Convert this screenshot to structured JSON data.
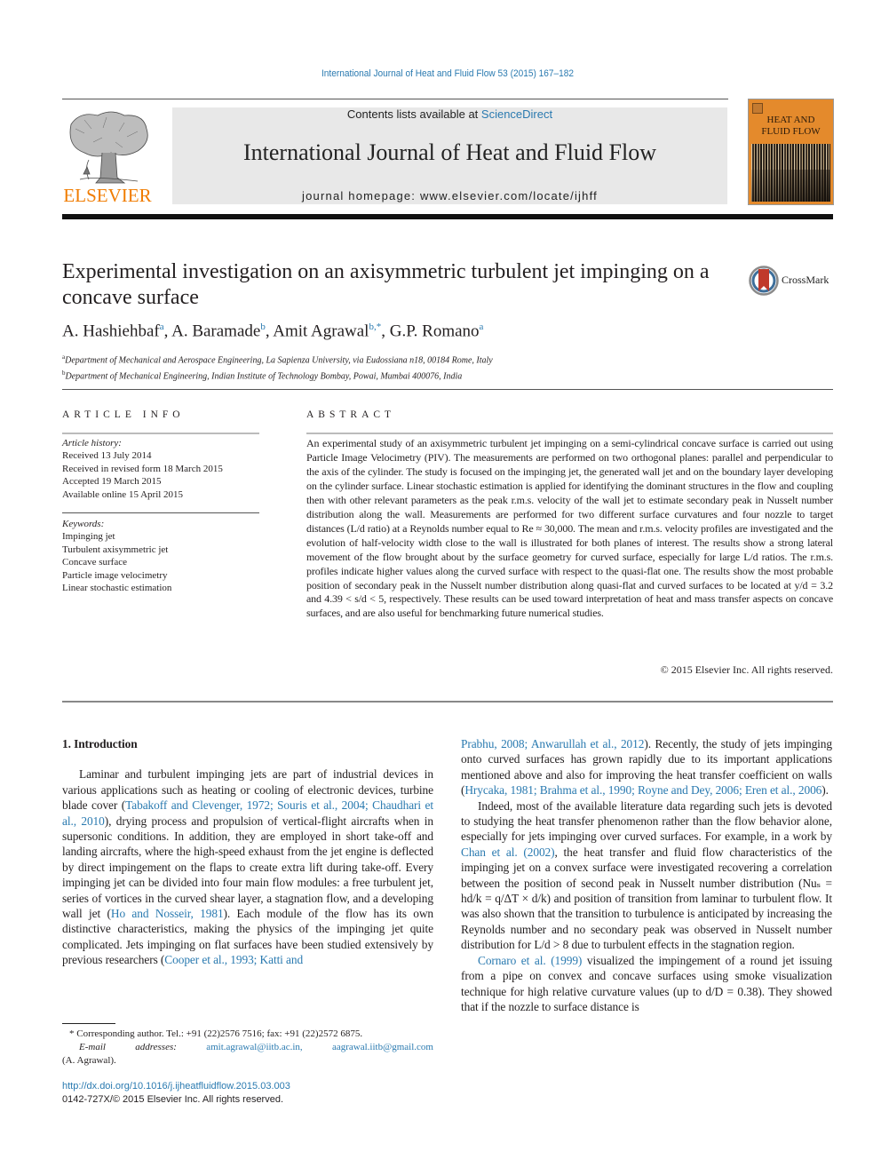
{
  "header": {
    "journal_ref": "International Journal of Heat and Fluid Flow 53 (2015) 167–182",
    "contents_prefix": "Contents lists available at ",
    "contents_link": "ScienceDirect",
    "journal_title": "International Journal of Heat and Fluid Flow",
    "homepage_prefix": "journal homepage: ",
    "homepage_url": "www.elsevier.com/locate/ijhff",
    "publisher_logo_text": "ELSEVIER",
    "cover_title_line1": "HEAT AND",
    "cover_title_line2": "FLUID FLOW",
    "colors": {
      "elsevier_orange": "#f07c00",
      "link_blue": "#2a7ab0",
      "cover_orange": "#e48a2c",
      "banner_gray": "#e8e8e8"
    }
  },
  "article": {
    "title": "Experimental investigation on an axisymmetric turbulent jet impinging on a concave surface",
    "crossmark_label": "CrossMark",
    "authors": [
      {
        "name": "A. Hashiehbaf",
        "sup": "a"
      },
      {
        "name": "A. Baramade",
        "sup": "b"
      },
      {
        "name": "Amit Agrawal",
        "sup": "b,*"
      },
      {
        "name": "G.P. Romano",
        "sup": "a"
      }
    ],
    "affiliations": [
      {
        "sup": "a",
        "text": "Department of Mechanical and Aerospace Engineering, La Sapienza University, via Eudossiana n18, 00184 Rome, Italy"
      },
      {
        "sup": "b",
        "text": "Department of Mechanical Engineering, Indian Institute of Technology Bombay, Powai, Mumbai 400076, India"
      }
    ]
  },
  "article_info": {
    "heading": "ARTICLE INFO",
    "history_label": "Article history:",
    "history": [
      "Received 13 July 2014",
      "Received in revised form 18 March 2015",
      "Accepted 19 March 2015",
      "Available online 15 April 2015"
    ],
    "keywords_label": "Keywords:",
    "keywords": [
      "Impinging jet",
      "Turbulent axisymmetric jet",
      "Concave surface",
      "Particle image velocimetry",
      "Linear stochastic estimation"
    ]
  },
  "abstract": {
    "heading": "ABSTRACT",
    "text": "An experimental study of an axisymmetric turbulent jet impinging on a semi-cylindrical concave surface is carried out using Particle Image Velocimetry (PIV). The measurements are performed on two orthogonal planes: parallel and perpendicular to the axis of the cylinder. The study is focused on the impinging jet, the generated wall jet and on the boundary layer developing on the cylinder surface. Linear stochastic estimation is applied for identifying the dominant structures in the flow and coupling then with other relevant parameters as the peak r.m.s. velocity of the wall jet to estimate secondary peak in Nusselt number distribution along the wall. Measurements are performed for two different surface curvatures and four nozzle to target distances (L/d ratio) at a Reynolds number equal to Re ≈ 30,000. The mean and r.m.s. velocity profiles are investigated and the evolution of half-velocity width close to the wall is illustrated for both planes of interest. The results show a strong lateral movement of the flow brought about by the surface geometry for curved surface, especially for large L/d ratios. The r.m.s. profiles indicate higher values along the curved surface with respect to the quasi-flat one. The results show the most probable position of secondary peak in the Nusselt number distribution along quasi-flat and curved surfaces to be located at y/d = 3.2 and 4.39 < s/d < 5, respectively. These results can be used toward interpretation of heat and mass transfer aspects on concave surfaces, and are also useful for benchmarking future numerical studies.",
    "copyright": "© 2015 Elsevier Inc. All rights reserved."
  },
  "body": {
    "section_heading": "1. Introduction",
    "left_p1": [
      {
        "t": "Laminar and turbulent impinging jets are part of industrial devices in various applications such as heating or cooling of electronic devices, turbine blade cover ("
      },
      {
        "t": "Tabakoff and Clevenger, 1972; Souris et al., 2004; Chaudhari et al., 2010",
        "link": true
      },
      {
        "t": "), drying process and propulsion of vertical-flight aircrafts when in supersonic conditions. In addition, they are employed in short take-off and landing aircrafts, where the high-speed exhaust from the jet engine is deflected by direct impingement on the flaps to create extra lift during take-off. Every impinging jet can be divided into four main flow modules: a free turbulent jet, series of vortices in the curved shear layer, a stagnation flow, and a developing wall jet ("
      },
      {
        "t": "Ho and Nosseir, 1981",
        "link": true
      },
      {
        "t": "). Each module of the flow has its own distinctive characteristics, making the physics of the impinging jet quite complicated. Jets impinging on flat surfaces have been studied extensively by previous researchers ("
      },
      {
        "t": "Cooper et al., 1993; Katti and",
        "link": true
      }
    ],
    "right_p1": [
      {
        "t": "Prabhu, 2008; Anwarullah et al., 2012",
        "link": true
      },
      {
        "t": "). Recently, the study of jets impinging onto curved surfaces has grown rapidly due to its important applications mentioned above and also for improving the heat transfer coefficient on walls ("
      },
      {
        "t": "Hrycaka, 1981; Brahma et al., 1990; Royne and Dey, 2006; Eren et al., 2006",
        "link": true
      },
      {
        "t": ")."
      }
    ],
    "right_p2": [
      {
        "t": "Indeed, most of the available literature data regarding such jets is devoted to studying the heat transfer phenomenon rather than the flow behavior alone, especially for jets impinging over curved surfaces. For example, in a work by "
      },
      {
        "t": "Chan et al. (2002)",
        "link": true
      },
      {
        "t": ", the heat transfer and fluid flow characteristics of the impinging jet on a convex surface were investigated recovering a correlation between the position of second peak in Nusselt number distribution (Nuₛ = hd/k = q/ΔT × d/k) and position of transition from laminar to turbulent flow. It was also shown that the transition to turbulence is anticipated by increasing the Reynolds number and no secondary peak was observed in Nusselt number distribution for L/d > 8 due to turbulent effects in the stagnation region."
      }
    ],
    "right_p3": [
      {
        "t": "Cornaro et al. (1999)",
        "link": true
      },
      {
        "t": " visualized the impingement of a round jet issuing from a pipe on convex and concave surfaces using smoke visualization technique for high relative curvature values (up to d/D = 0.38). They showed that if the nozzle to surface distance is"
      }
    ]
  },
  "footnote": {
    "corresponding": "* Corresponding author. Tel.: +91 (22)2576 7516; fax: +91 (22)2572 6875.",
    "email_label_1": "E-mail",
    "email_label_2": "addresses:",
    "email_1": "amit.agrawal@iitb.ac.in,",
    "email_2": "aagrawal.iitb@gmail.com",
    "email_owner": "(A. Agrawal)."
  },
  "doi": {
    "url": "http://dx.doi.org/10.1016/j.ijheatfluidflow.2015.03.003",
    "issn_line": "0142-727X/© 2015 Elsevier Inc. All rights reserved."
  }
}
